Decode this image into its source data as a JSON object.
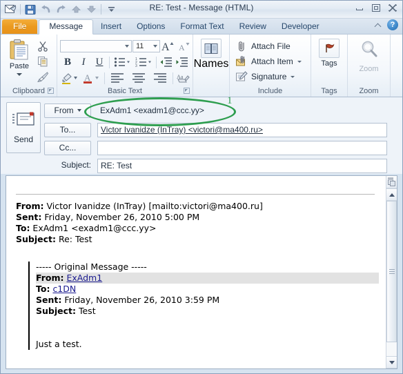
{
  "window": {
    "title": "RE: Test  -  Message (HTML)",
    "quick_access": [
      {
        "name": "office-envelope-icon",
        "label": "Office"
      },
      {
        "name": "save-icon",
        "label": "Save"
      },
      {
        "name": "undo-icon",
        "label": "Undo"
      },
      {
        "name": "redo-icon",
        "label": "Redo"
      },
      {
        "name": "previous-item-icon",
        "label": "Previous Item"
      },
      {
        "name": "next-item-icon",
        "label": "Next Item"
      },
      {
        "name": "customize-qat-icon",
        "label": "Customize Quick Access Toolbar"
      }
    ],
    "controls": {
      "minimize": "Minimize",
      "maximize": "Maximize",
      "close": "Close"
    }
  },
  "tabs": [
    {
      "label": "File",
      "type": "file"
    },
    {
      "label": "Message",
      "type": "active"
    },
    {
      "label": "Insert",
      "type": "normal"
    },
    {
      "label": "Options",
      "type": "normal"
    },
    {
      "label": "Format Text",
      "type": "normal"
    },
    {
      "label": "Review",
      "type": "normal"
    },
    {
      "label": "Developer",
      "type": "normal"
    }
  ],
  "tab_right": {
    "collapse_label": "Minimize the Ribbon",
    "help_label": "?"
  },
  "ribbon": {
    "clipboard": {
      "group_label": "Clipboard",
      "paste_label": "Paste",
      "cut_label": "Cut",
      "copy_label": "Copy",
      "format_painter_label": "Format Painter"
    },
    "basic_text": {
      "group_label": "Basic Text",
      "font_name": "",
      "font_size": "11",
      "grow_font": "A",
      "shrink_font": "A",
      "bold": "B",
      "italic": "I",
      "underline": "U",
      "bullets": "Bullets",
      "numbering": "Numbering",
      "decrease_indent": "Decrease Indent",
      "increase_indent": "Increase Indent",
      "text_highlight": "Text Highlight Color",
      "font_color": "A",
      "align_left": "Align Text Left",
      "align_center": "Center",
      "align_right": "Align Text Right",
      "clear_formatting": "Clear Formatting"
    },
    "names": {
      "group_label": "",
      "names_label": "Names",
      "address_book_label": "Address Book"
    },
    "include": {
      "group_label": "Include",
      "items": [
        {
          "label": "Attach File",
          "icon": "paperclip-icon",
          "has_caret": false
        },
        {
          "label": "Attach Item",
          "icon": "attach-item-icon",
          "has_caret": true
        },
        {
          "label": "Signature",
          "icon": "signature-icon",
          "has_caret": true
        }
      ]
    },
    "tags": {
      "group_label": "Tags",
      "button_label": "Tags"
    },
    "zoom": {
      "group_label": "Zoom",
      "button_label": "Zoom"
    }
  },
  "compose": {
    "send_label": "Send",
    "from_label": "From",
    "from_value": "ExAdm1  <exadm1@ccc.yy>",
    "to_label": "To...",
    "to_value": "Victor Ivanidze (InTray) <victori@ma400.ru>",
    "cc_label": "Cc...",
    "cc_value": "",
    "subject_label": "Subject:",
    "subject_value": "RE: Test"
  },
  "annotation": {
    "number": "1",
    "color": "#2e9e4f"
  },
  "body": {
    "reply_headers": [
      {
        "label": "From:",
        "value": " Victor Ivanidze (InTray) [mailto:victori@ma400.ru]"
      },
      {
        "label": "Sent:",
        "value": " Friday, November 26, 2010 5:00 PM"
      },
      {
        "label": "To:",
        "value": " ExAdm1 <exadm1@ccc.yy>"
      },
      {
        "label": "Subject:",
        "value": " Re: Test"
      }
    ],
    "quoted": {
      "separator": "----- Original Message -----",
      "from_label": "From:",
      "from_link": "ExAdm1",
      "to_label": "To:",
      "to_link": "c1DN",
      "sent_label": "Sent:",
      "sent_value": " Friday, November 26, 2010 3:59 PM",
      "subject_label": "Subject:",
      "subject_value": " Test",
      "message": "Just a test."
    }
  },
  "scrollbar": {
    "split_label": "Split",
    "up_label": "Scroll Up",
    "down_label": "Scroll Down"
  }
}
